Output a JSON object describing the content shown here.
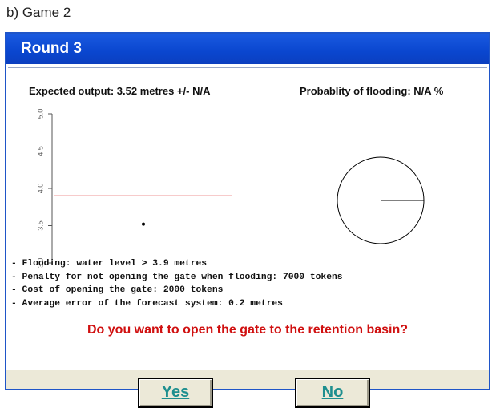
{
  "caption": "b) Game 2",
  "window": {
    "title": "Round 3"
  },
  "expected_output": {
    "label": "Expected output: 3.52 metres  +/- N/A"
  },
  "flooding_probability": {
    "label": "Probablity of flooding: N/A %"
  },
  "chart_data": [
    {
      "type": "scatter",
      "title": "Expected output: 3.52 metres  +/- N/A",
      "xlabel": "",
      "ylabel": "",
      "ylim": [
        3.0,
        5.0
      ],
      "yticks": [
        "3.0",
        "3.5",
        "4.0",
        "4.5",
        "5.0"
      ],
      "threshold_line": {
        "y": 3.9,
        "color": "#e03030"
      },
      "points": [
        {
          "x": 0.5,
          "y": 3.52
        }
      ]
    },
    {
      "type": "pie",
      "title": "Probablity of flooding: N/A %",
      "values": []
    }
  ],
  "rules": [
    "- Flooding: water level > 3.9 metres",
    "- Penalty for not opening the gate when flooding: 7000 tokens",
    "- Cost of opening the gate: 2000 tokens",
    "- Average error of the forecast system: 0.2 metres"
  ],
  "question": "Do you want to open the gate to the retention basin?",
  "buttons": {
    "yes": "Yes",
    "no": "No"
  },
  "colors": {
    "titlebar": "#0a46cf",
    "question": "#d01010",
    "button_text": "#1e8f8f",
    "footer": "#ece9d8"
  }
}
